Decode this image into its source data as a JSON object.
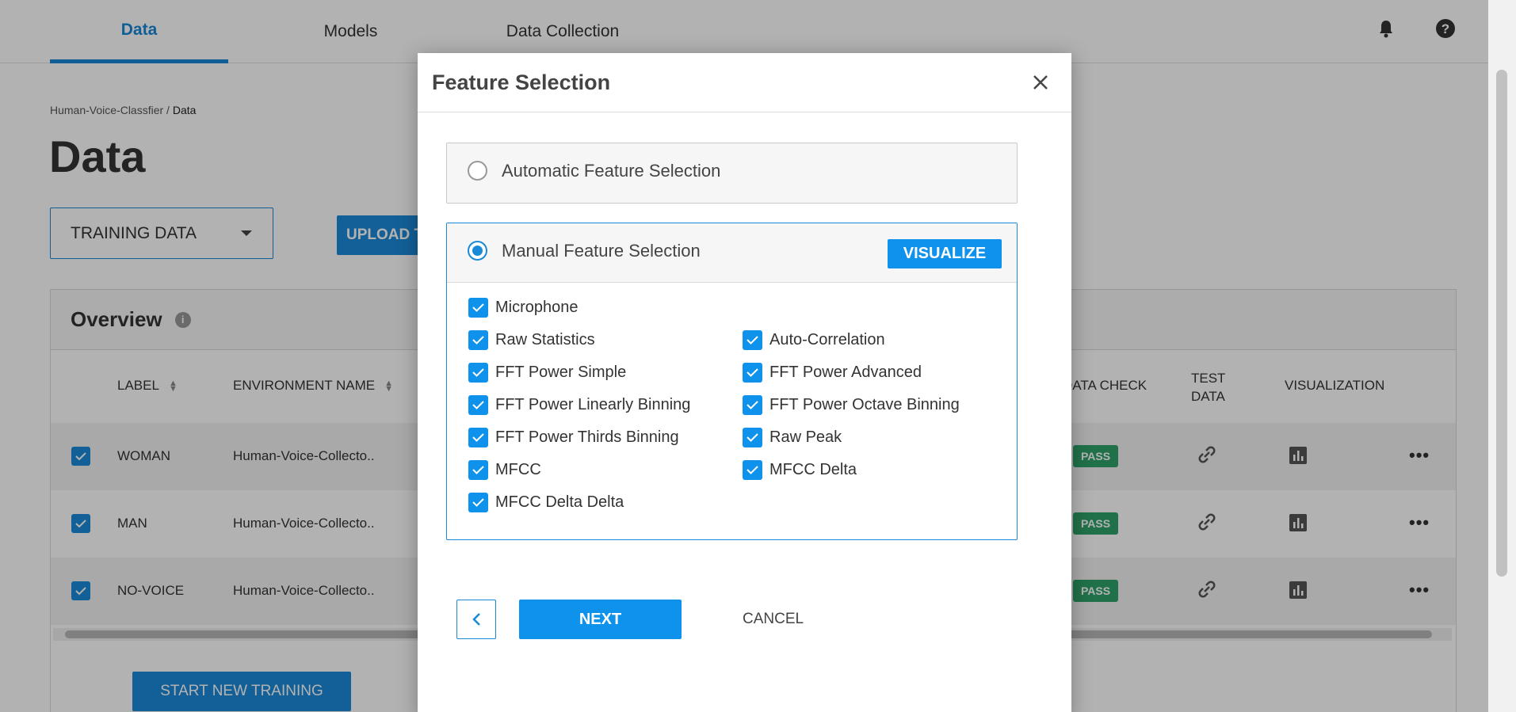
{
  "nav": {
    "tabs": [
      {
        "label": "Data",
        "active": true
      },
      {
        "label": "Models",
        "active": false
      },
      {
        "label": "Data Collection",
        "active": false
      }
    ],
    "icons": [
      "bell-icon",
      "help-icon"
    ]
  },
  "breadcrumb": {
    "parent": "Human-Voice-Classfier",
    "separator": " / ",
    "current": "Data"
  },
  "page": {
    "title": "Data"
  },
  "data_select": {
    "value": "TRAINING DATA"
  },
  "upload_button": {
    "label": "UPLOAD TRAINING DATA"
  },
  "overview": {
    "title": "Overview",
    "columns": [
      "LABEL",
      "ENVIRONMENT NAME",
      "DATA CHECK",
      "TEST DATA",
      "VISUALIZATION"
    ],
    "rows": [
      {
        "label": "WOMAN",
        "environment": "Human-Voice-Collecto..",
        "status": "PASS"
      },
      {
        "label": "MAN",
        "environment": "Human-Voice-Collecto..",
        "status": "PASS"
      },
      {
        "label": "NO-VOICE",
        "environment": "Human-Voice-Collecto..",
        "status": "PASS"
      }
    ],
    "start_button": "START NEW TRAINING"
  },
  "modal": {
    "title": "Feature Selection",
    "auto_option": "Automatic Feature Selection",
    "manual_option": "Manual Feature Selection",
    "visualize_button": "VISUALIZE",
    "features": [
      "Microphone",
      "Raw Statistics",
      "Auto-Correlation",
      "FFT Power Simple",
      "FFT Power Advanced",
      "FFT Power Linearly Binning",
      "FFT Power Octave Binning",
      "FFT Power Thirds Binning",
      "Raw Peak",
      "MFCC",
      "MFCC Delta",
      "MFCC Delta Delta"
    ],
    "next_button": "NEXT",
    "cancel_button": "CANCEL"
  },
  "colors": {
    "accent": "#1a8ad8",
    "pass": "#2ea36b"
  }
}
